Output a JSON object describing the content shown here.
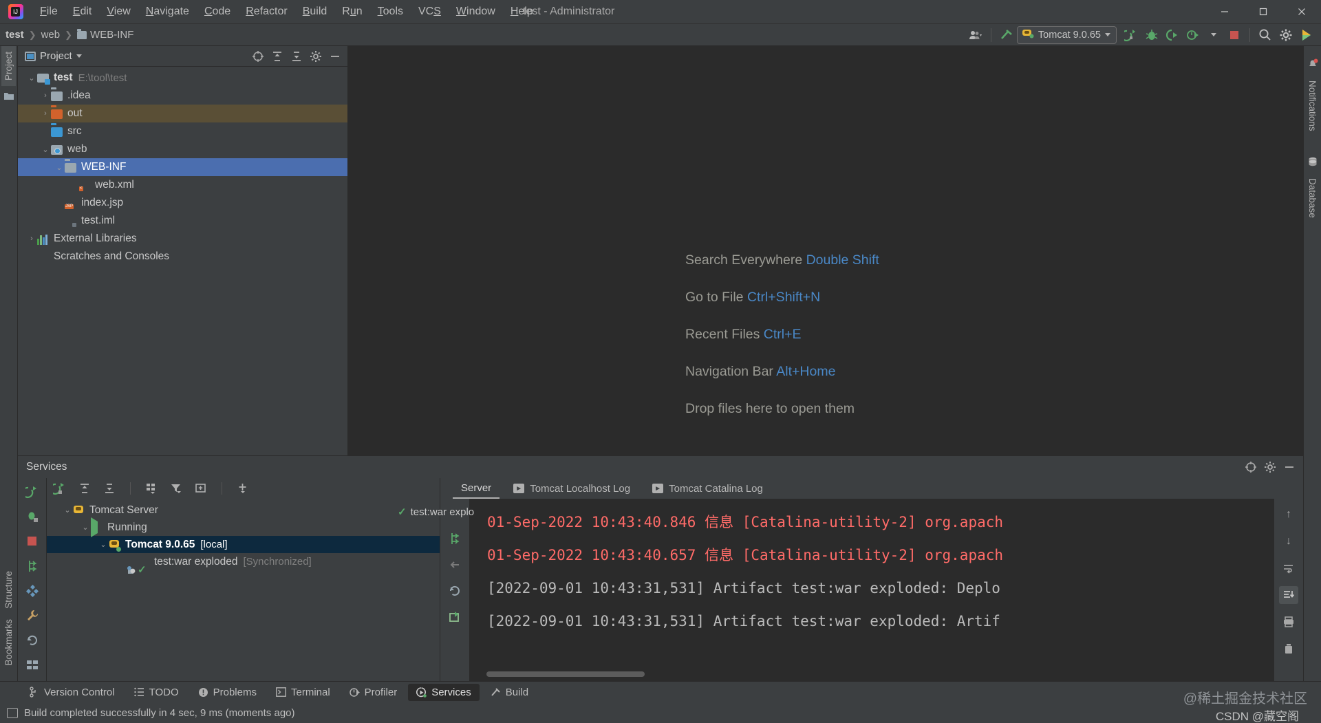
{
  "titlebar": {
    "window_title": "test - Administrator",
    "menus": [
      "File",
      "Edit",
      "View",
      "Navigate",
      "Code",
      "Refactor",
      "Build",
      "Run",
      "Tools",
      "VCS",
      "Window",
      "Help"
    ],
    "controls": {
      "minimize": "—",
      "maximize": "❐",
      "close": "✕"
    }
  },
  "navbar": {
    "breadcrumb": [
      "test",
      "web",
      "WEB-INF"
    ],
    "run_config": "Tomcat 9.0.65",
    "icons": [
      "user-settings-icon",
      "hammer-icon",
      "run-icon",
      "debug-icon",
      "run-coverage-icon",
      "profiler-icon",
      "stop-icon",
      "search-icon",
      "settings-gear-icon",
      "ide-feedback-icon"
    ]
  },
  "left_stripe": {
    "tabs": [
      "Project"
    ],
    "bottom_tabs": [
      "Structure",
      "Bookmarks"
    ]
  },
  "right_stripe": {
    "tabs": [
      "Notifications",
      "Database"
    ]
  },
  "project_panel": {
    "title": "Project",
    "header_icons": [
      "select-opened-file-icon",
      "expand-all-icon",
      "collapse-all-icon",
      "settings-gear-icon",
      "hide-icon"
    ],
    "tree": [
      {
        "label": "test",
        "sub": "E:\\tool\\test",
        "indent": 0,
        "arrow": "⌄",
        "icon": "module-icon",
        "bold": true,
        "state": ""
      },
      {
        "label": ".idea",
        "sub": "",
        "indent": 1,
        "arrow": "›",
        "icon": "folder-icon",
        "bold": false,
        "state": ""
      },
      {
        "label": "out",
        "sub": "",
        "indent": 1,
        "arrow": "›",
        "icon": "folder-orange-icon",
        "bold": false,
        "state": "highlight"
      },
      {
        "label": "src",
        "sub": "",
        "indent": 1,
        "arrow": "",
        "icon": "folder-blue-icon",
        "bold": false,
        "state": ""
      },
      {
        "label": "web",
        "sub": "",
        "indent": 1,
        "arrow": "⌄",
        "icon": "web-folder-icon",
        "bold": false,
        "state": ""
      },
      {
        "label": "WEB-INF",
        "sub": "",
        "indent": 2,
        "arrow": "⌄",
        "icon": "folder-icon",
        "bold": false,
        "state": "sel"
      },
      {
        "label": "web.xml",
        "sub": "",
        "indent": 3,
        "arrow": "",
        "icon": "xml-file-icon",
        "bold": false,
        "state": ""
      },
      {
        "label": "index.jsp",
        "sub": "",
        "indent": 2,
        "arrow": "",
        "icon": "jsp-file-icon",
        "bold": false,
        "state": ""
      },
      {
        "label": "test.iml",
        "sub": "",
        "indent": 2,
        "arrow": "",
        "icon": "iml-file-icon",
        "bold": false,
        "state": ""
      },
      {
        "label": "External Libraries",
        "sub": "",
        "indent": 0,
        "arrow": "›",
        "icon": "library-icon",
        "bold": false,
        "state": ""
      },
      {
        "label": "Scratches and Consoles",
        "sub": "",
        "indent": 0,
        "arrow": "",
        "icon": "scratches-icon",
        "bold": false,
        "state": ""
      }
    ]
  },
  "editor": {
    "hints": [
      {
        "label": "Search Everywhere",
        "key": "Double Shift"
      },
      {
        "label": "Go to File",
        "key": "Ctrl+Shift+N"
      },
      {
        "label": "Recent Files",
        "key": "Ctrl+E"
      },
      {
        "label": "Navigation Bar",
        "key": "Alt+Home"
      },
      {
        "label": "Drop files here to open them",
        "key": ""
      }
    ]
  },
  "services": {
    "title": "Services",
    "header_icons": [
      "target-icon",
      "settings-gear-icon",
      "hide-icon"
    ],
    "toolbar_icons": [
      "rerun-icon",
      "debug-icon",
      "stop-icon",
      "deploy-icon",
      "structure-icon",
      "wrench-icon",
      "rotate-icon",
      "grid-icon"
    ],
    "top_toolbar_icons": [
      "rerun-icon",
      "expand-all-icon",
      "collapse-all-icon",
      "group-icon",
      "filter-icon",
      "add-tab-icon",
      "add-icon"
    ],
    "tabs": [
      {
        "label": "Server",
        "icon": "",
        "active": true
      },
      {
        "label": "Tomcat Localhost Log",
        "icon": "log-icon",
        "active": false
      },
      {
        "label": "Tomcat Catalina Log",
        "icon": "log-icon",
        "active": false
      }
    ],
    "tree": [
      {
        "label": "Tomcat Server",
        "sub": "",
        "indent": 0,
        "arrow": "⌄",
        "icon": "tomcat-icon",
        "bold": false,
        "state": ""
      },
      {
        "label": "Running",
        "sub": "",
        "indent": 1,
        "arrow": "⌄",
        "icon": "play-icon",
        "bold": false,
        "state": ""
      },
      {
        "label": "Tomcat 9.0.65",
        "sub": "[local]",
        "indent": 2,
        "arrow": "⌄",
        "icon": "tomcat-running-icon",
        "bold": true,
        "state": "sel"
      },
      {
        "label": "test:war exploded",
        "sub": "[Synchronized]",
        "indent": 3,
        "arrow": "",
        "icon": "artifact-ok-icon",
        "bold": false,
        "state": ""
      }
    ],
    "selected_artifact": "test:war explo",
    "gutter_icons": [
      "check-icon",
      "rerun-icon",
      "back-icon",
      "restart-icon",
      "redeploy-icon"
    ],
    "log_lines": [
      {
        "text": "[2022-09-01 10:43:31,531] Artifact test:war exploded: Artif",
        "color": "normal"
      },
      {
        "text": "[2022-09-01 10:43:31,531] Artifact test:war exploded: Deplo",
        "color": "normal"
      },
      {
        "text": "01-Sep-2022 10:43:40.657 信息 [Catalina-utility-2] org.apach",
        "color": "red"
      },
      {
        "text": "01-Sep-2022 10:43:40.846 信息 [Catalina-utility-2] org.apach",
        "color": "red"
      }
    ],
    "right_icons": [
      "scroll-up-icon",
      "scroll-down-icon",
      "soft-wrap-icon",
      "scroll-to-end-icon",
      "print-icon",
      "trash-icon"
    ]
  },
  "bottom_bar": {
    "items": [
      {
        "label": "Version Control",
        "icon": "branch-icon",
        "active": false
      },
      {
        "label": "TODO",
        "icon": "list-icon",
        "active": false
      },
      {
        "label": "Problems",
        "icon": "warning-icon",
        "active": false
      },
      {
        "label": "Terminal",
        "icon": "terminal-icon",
        "active": false
      },
      {
        "label": "Profiler",
        "icon": "profiler-icon",
        "active": false
      },
      {
        "label": "Services",
        "icon": "services-icon",
        "active": true
      },
      {
        "label": "Build",
        "icon": "build-icon",
        "active": false
      }
    ]
  },
  "status_bar": {
    "message": "Build completed successfully in 4 sec, 9 ms (moments ago)",
    "watermark_top": "@稀土掘金技术社区",
    "watermark_bottom": "CSDN @藏空阁"
  },
  "colors": {
    "accent_blue": "#4b6eaf",
    "link_blue": "#4a88c7",
    "error_red": "#ff6b68",
    "green": "#59a869",
    "panel_bg": "#3c3f41",
    "editor_bg": "#2b2b2b"
  }
}
